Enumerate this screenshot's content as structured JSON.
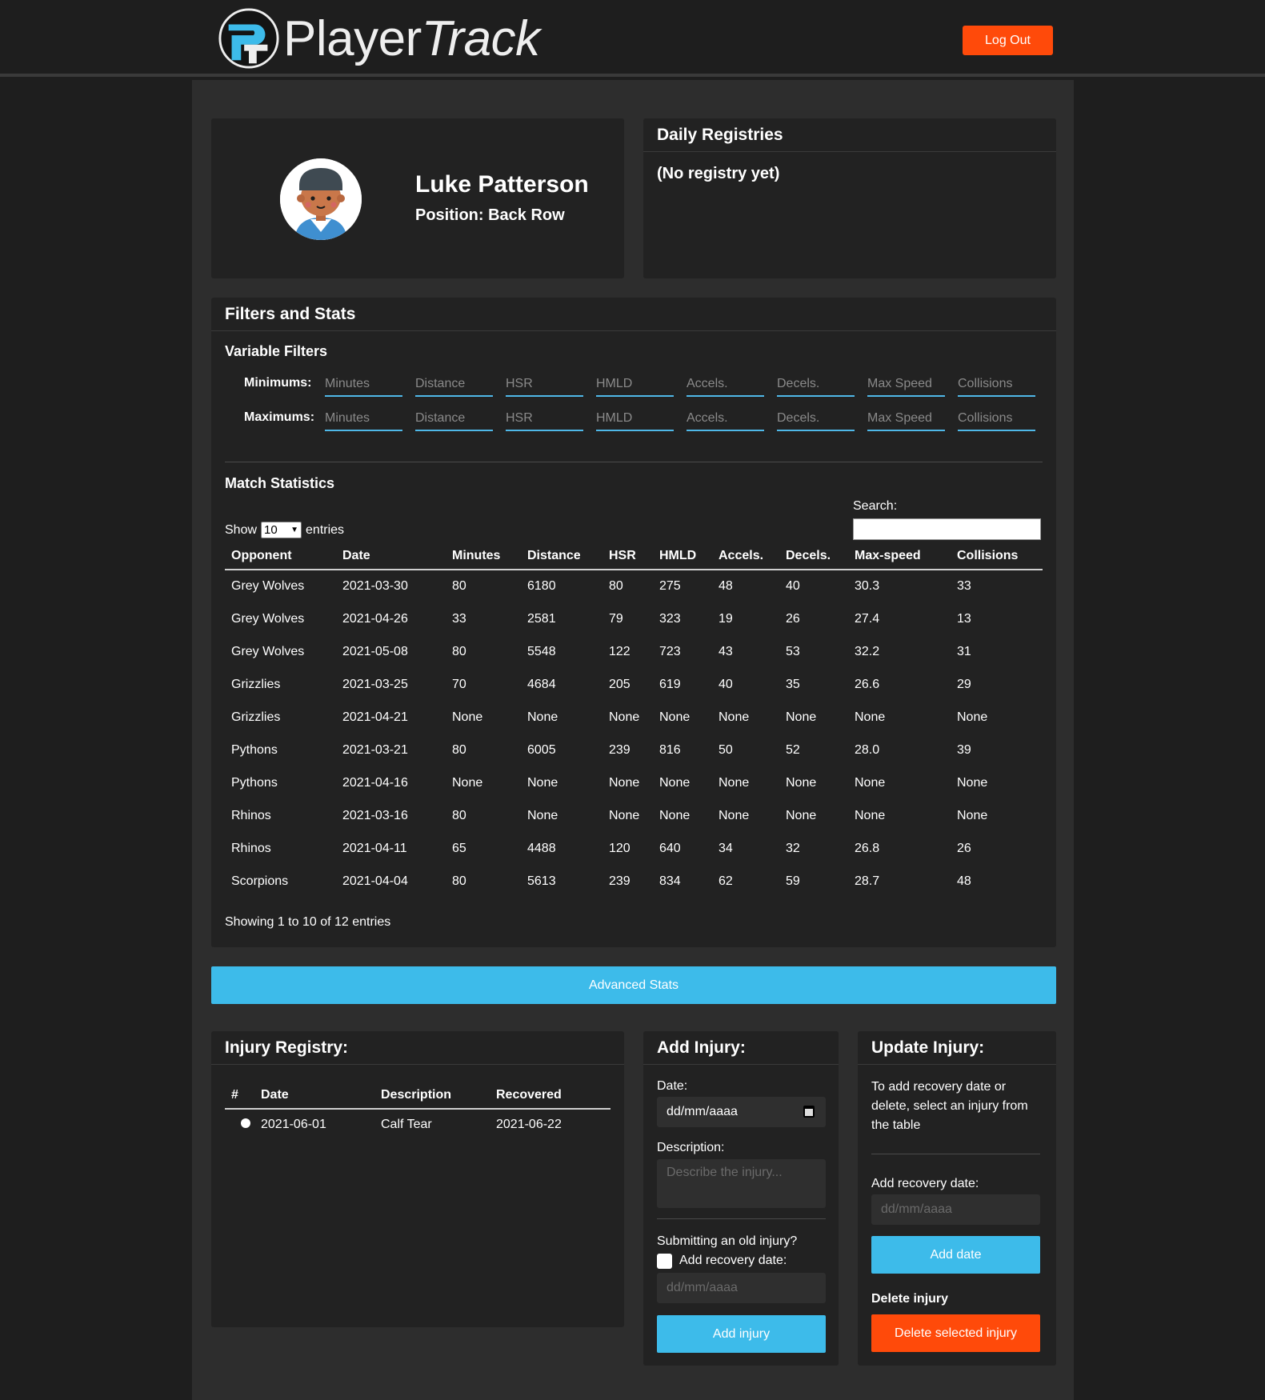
{
  "header": {
    "brand_part1": "Player",
    "brand_part2": "Track",
    "logout_label": "Log Out"
  },
  "colors": {
    "accent_orange": "#ff4a0a",
    "accent_blue": "#3dbbea",
    "background": "#1e1e1e",
    "panel": "#222222"
  },
  "profile": {
    "name": "Luke Patterson",
    "position": "Position: Back Row"
  },
  "daily": {
    "title": "Daily Registries",
    "empty": "(No registry yet)"
  },
  "filters": {
    "title": "Filters and Stats",
    "variable_filters": "Variable Filters",
    "minimums_label": "Minimums:",
    "maximums_label": "Maximums:",
    "placeholders": [
      "Minutes",
      "Distance",
      "HSR",
      "HMLD",
      "Accels.",
      "Decels.",
      "Max Speed",
      "Collisions"
    ]
  },
  "match": {
    "title": "Match Statistics",
    "show_label": "Show",
    "entries_label": "entries",
    "page_size": "10",
    "search_label": "Search:",
    "search_value": "",
    "columns": [
      "Opponent",
      "Date",
      "Minutes",
      "Distance",
      "HSR",
      "HMLD",
      "Accels.",
      "Decels.",
      "Max-speed",
      "Collisions"
    ],
    "rows": [
      [
        "Grey Wolves",
        "2021-03-30",
        "80",
        "6180",
        "80",
        "275",
        "48",
        "40",
        "30.3",
        "33"
      ],
      [
        "Grey Wolves",
        "2021-04-26",
        "33",
        "2581",
        "79",
        "323",
        "19",
        "26",
        "27.4",
        "13"
      ],
      [
        "Grey Wolves",
        "2021-05-08",
        "80",
        "5548",
        "122",
        "723",
        "43",
        "53",
        "32.2",
        "31"
      ],
      [
        "Grizzlies",
        "2021-03-25",
        "70",
        "4684",
        "205",
        "619",
        "40",
        "35",
        "26.6",
        "29"
      ],
      [
        "Grizzlies",
        "2021-04-21",
        "None",
        "None",
        "None",
        "None",
        "None",
        "None",
        "None",
        "None"
      ],
      [
        "Pythons",
        "2021-03-21",
        "80",
        "6005",
        "239",
        "816",
        "50",
        "52",
        "28.0",
        "39"
      ],
      [
        "Pythons",
        "2021-04-16",
        "None",
        "None",
        "None",
        "None",
        "None",
        "None",
        "None",
        "None"
      ],
      [
        "Rhinos",
        "2021-03-16",
        "80",
        "None",
        "None",
        "None",
        "None",
        "None",
        "None",
        "None"
      ],
      [
        "Rhinos",
        "2021-04-11",
        "65",
        "4488",
        "120",
        "640",
        "34",
        "32",
        "26.8",
        "26"
      ],
      [
        "Scorpions",
        "2021-04-04",
        "80",
        "5613",
        "239",
        "834",
        "62",
        "59",
        "28.7",
        "48"
      ]
    ],
    "showing": "Showing 1 to 10 of 12 entries"
  },
  "advanced_label": "Advanced Stats",
  "injury_registry": {
    "title": "Injury Registry:",
    "columns": [
      "#",
      "Date",
      "Description",
      "Recovered"
    ],
    "rows": [
      {
        "date": "2021-06-01",
        "description": "Calf Tear",
        "recovered": "2021-06-22"
      }
    ]
  },
  "add_injury": {
    "title": "Add Injury:",
    "date_label": "Date:",
    "date_value": "dd/mm/aaaa",
    "description_label": "Description:",
    "description_placeholder": "Describe the injury...",
    "old_injury_label": "Submitting an old injury?",
    "recovery_checkbox_label": "Add recovery date:",
    "recovery_placeholder": "dd/mm/aaaa",
    "submit_label": "Add injury"
  },
  "update_injury": {
    "title": "Update Injury:",
    "note": "To add recovery date or delete, select an injury from the table",
    "recovery_label": "Add recovery date:",
    "recovery_placeholder": "dd/mm/aaaa",
    "add_date_label": "Add date",
    "delete_heading": "Delete injury",
    "delete_label": "Delete selected injury"
  }
}
